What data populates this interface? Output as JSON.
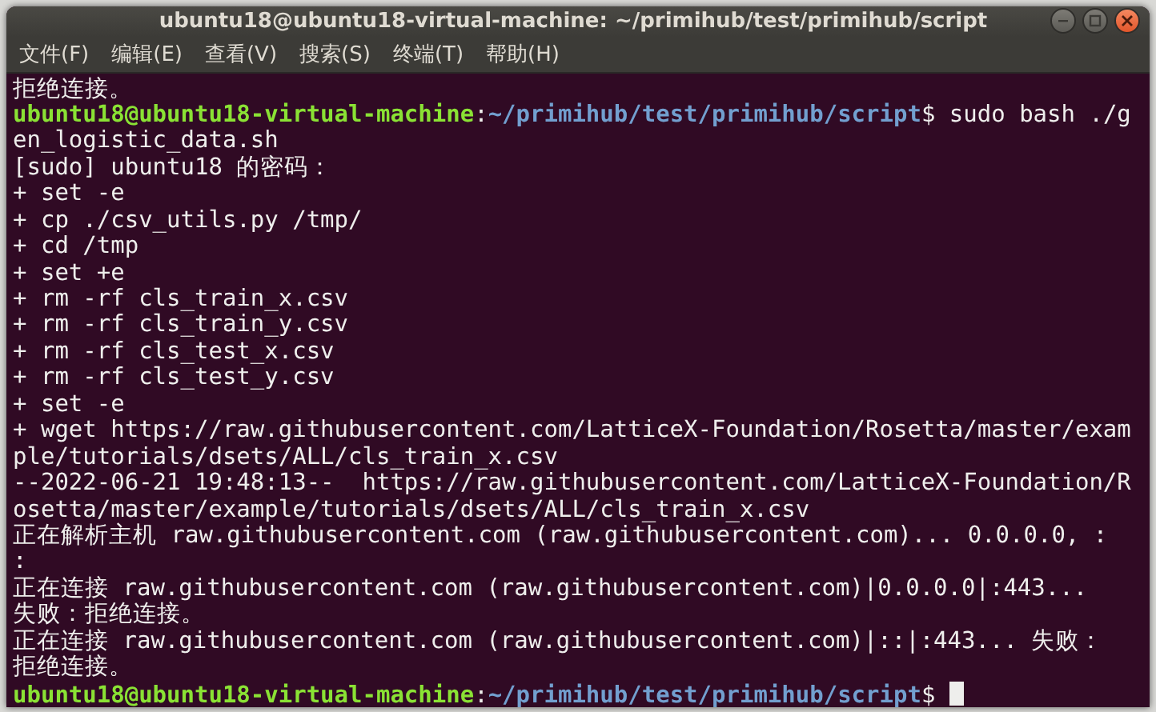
{
  "window": {
    "title": "ubuntu18@ubuntu18-virtual-machine: ~/primihub/test/primihub/script"
  },
  "menu": [
    "文件(F)",
    "编辑(E)",
    "查看(V)",
    "搜索(S)",
    "终端(T)",
    "帮助(H)"
  ],
  "terminal": {
    "lines": [
      {
        "kind": "text",
        "text": "拒绝连接。"
      },
      {
        "kind": "prompt",
        "user": "ubuntu18@ubuntu18-virtual-machine",
        "path": "~/primihub/test/primihub/script",
        "separator": ":",
        "symbol": "$",
        "command": " sudo bash ./g"
      },
      {
        "kind": "text",
        "text": "en_logistic_data.sh"
      },
      {
        "kind": "text",
        "text": "[sudo] ubuntu18 的密码："
      },
      {
        "kind": "text",
        "text": "+ set -e"
      },
      {
        "kind": "text",
        "text": "+ cp ./csv_utils.py /tmp/"
      },
      {
        "kind": "text",
        "text": "+ cd /tmp"
      },
      {
        "kind": "text",
        "text": "+ set +e"
      },
      {
        "kind": "text",
        "text": "+ rm -rf cls_train_x.csv"
      },
      {
        "kind": "text",
        "text": "+ rm -rf cls_train_y.csv"
      },
      {
        "kind": "text",
        "text": "+ rm -rf cls_test_x.csv"
      },
      {
        "kind": "text",
        "text": "+ rm -rf cls_test_y.csv"
      },
      {
        "kind": "text",
        "text": "+ set -e"
      },
      {
        "kind": "text",
        "text": "+ wget https://raw.githubusercontent.com/LatticeX-Foundation/Rosetta/master/exam"
      },
      {
        "kind": "text",
        "text": "ple/tutorials/dsets/ALL/cls_train_x.csv"
      },
      {
        "kind": "text",
        "text": "--2022-06-21 19:48:13--  https://raw.githubusercontent.com/LatticeX-Foundation/R"
      },
      {
        "kind": "text",
        "text": "osetta/master/example/tutorials/dsets/ALL/cls_train_x.csv"
      },
      {
        "kind": "text",
        "text": "正在解析主机 raw.githubusercontent.com (raw.githubusercontent.com)... 0.0.0.0, :"
      },
      {
        "kind": "text",
        "text": ":"
      },
      {
        "kind": "text",
        "text": "正在连接 raw.githubusercontent.com (raw.githubusercontent.com)|0.0.0.0|:443..."
      },
      {
        "kind": "text",
        "text": "失败：拒绝连接。"
      },
      {
        "kind": "text",
        "text": "正在连接 raw.githubusercontent.com (raw.githubusercontent.com)|::|:443... 失败："
      },
      {
        "kind": "text",
        "text": "拒绝连接。"
      },
      {
        "kind": "prompt",
        "user": "ubuntu18@ubuntu18-virtual-machine",
        "path": "~/primihub/test/primihub/script",
        "separator": ":",
        "symbol": "$",
        "cursor": true
      }
    ]
  }
}
